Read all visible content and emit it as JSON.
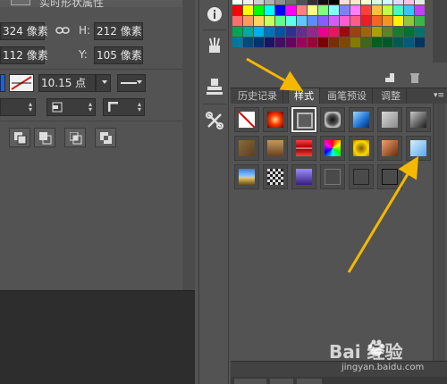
{
  "left_panel": {
    "title": "实时形状属性",
    "width_value": "324 像素",
    "height_label": "H:",
    "height_value": "212 像素",
    "x_value": "112 像素",
    "y_label": "Y:",
    "y_value": "105 像素",
    "stroke_width": "10.15 点"
  },
  "panel_tabs": [
    {
      "label": "历史记录"
    },
    {
      "label": "样式"
    },
    {
      "label": "画笔预设"
    },
    {
      "label": "调整"
    }
  ],
  "active_tab_index": 1,
  "tool_icons": [
    "info-icon",
    "brush-presets-icon",
    "clone-source-icon",
    "tools-icon"
  ],
  "style_cells": [
    "none-style",
    "red-glow",
    "outlined-frame",
    "chrome-button",
    "blue-glass",
    "gray-bevel",
    "dark-gradient",
    "brown-texture",
    "wood-texture",
    "red-frame",
    "rainbow-texture",
    "yellow-frame",
    "copper-gradient",
    "light-blue-bevel",
    "landscape-style",
    "checker-texture",
    "purple-gradient",
    "gray-outline",
    "dark-outline",
    "black-outline"
  ],
  "selected_style_index": 2,
  "annotation": {
    "color": "#f5b800",
    "arrows": [
      "to-styles-tab",
      "to-new-style-swatch"
    ]
  },
  "watermark": {
    "brand": "Bai 经验",
    "url": "jingyan.baidu.com"
  }
}
